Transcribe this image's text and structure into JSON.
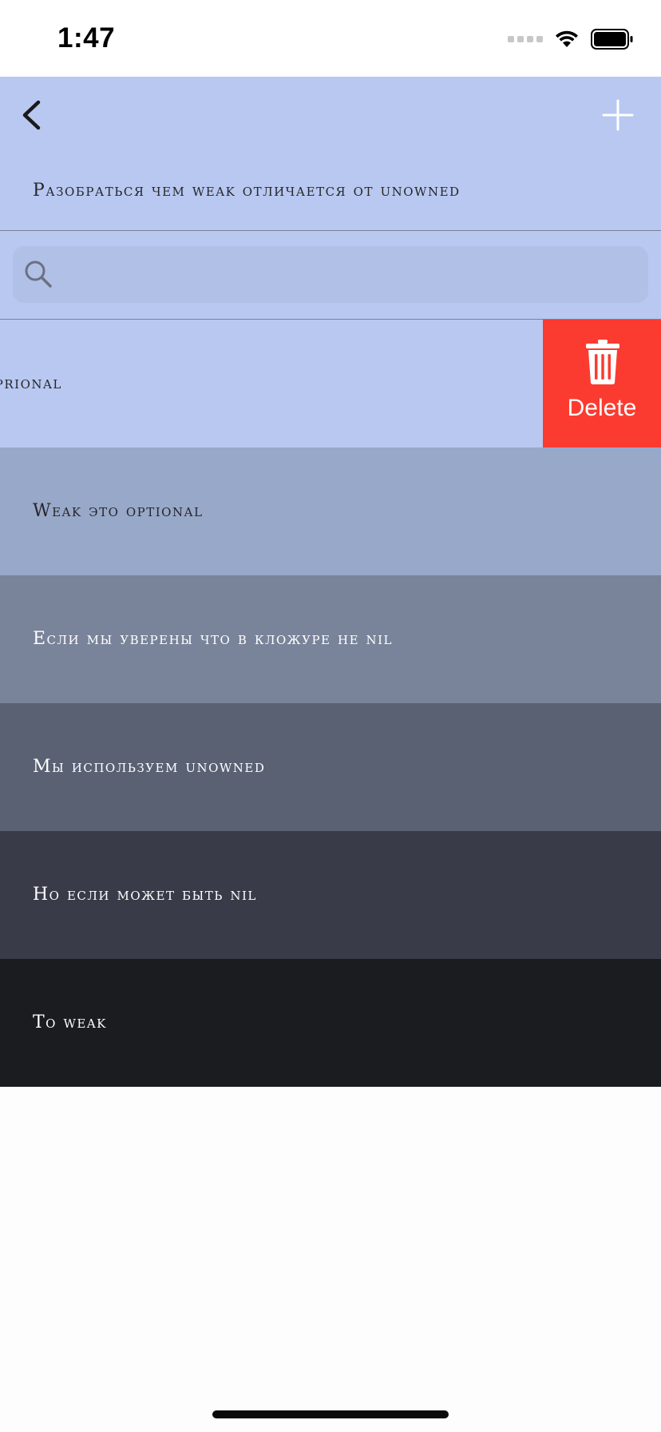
{
  "status_bar": {
    "time": "1:47"
  },
  "nav": {
    "title": "Разобраться чем weak отличается от unowned"
  },
  "search": {
    "placeholder": ""
  },
  "rows": [
    {
      "text": "Unowned не oprional",
      "visible_text": "ed не oprional",
      "bg": "#b8c8f1",
      "fg": "#262626",
      "swiped": true
    },
    {
      "text": "Weak это optional",
      "bg": "#98a8c9",
      "fg": "#262626"
    },
    {
      "text": "Если мы уверены что в кложуре не nil",
      "bg": "#798399",
      "fg": "#ffffff"
    },
    {
      "text": "Мы используем unowned",
      "bg": "#596173",
      "fg": "#ffffff"
    },
    {
      "text": "Но если может быть nil",
      "bg": "#393c48",
      "fg": "#ffffff"
    },
    {
      "text": "То weak",
      "bg": "#1b1c20",
      "fg": "#ffffff"
    }
  ],
  "swipe_action": {
    "label": "Delete",
    "color": "#fb3b30",
    "icon": "trash-icon"
  },
  "colors": {
    "nav_bg": "#b8c8f1",
    "search_field_bg": "#b0c0e6",
    "page_bg": "#fdfdfd"
  }
}
